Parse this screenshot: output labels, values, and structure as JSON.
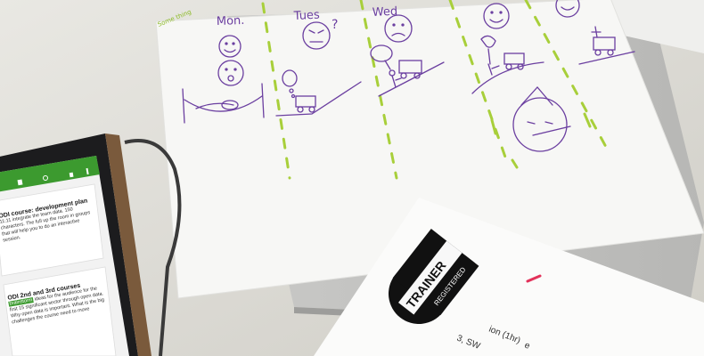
{
  "sketch": {
    "columns": [
      "Mon.",
      "Tues",
      "Wed"
    ],
    "question_mark": "?",
    "corner_note": "Some thing"
  },
  "phone": {
    "cards": [
      {
        "title": "ODI course: development plan",
        "body": "11:11 integrate the team data. 150 characters. The full up the room in groups that will help you to do an interactive session."
      },
      {
        "title": "ODI 2nd and 3rd courses",
        "highlight": "brainstorm",
        "body": "ideas for the audience for the first 15 significant sector through open data. Why open data is important. What is the big challenges the course need to move"
      }
    ],
    "accent_color": "#3c9a2f"
  },
  "flyer": {
    "logo_top": "TRAINER",
    "logo_bottom": "REGISTERED",
    "partial_lines": [
      "ion (1hr)",
      "3, SW",
      "e"
    ]
  },
  "colors": {
    "marker_purple": "#6b3fa0",
    "marker_green": "#a8cf3a",
    "red_mark": "#e2325a"
  }
}
